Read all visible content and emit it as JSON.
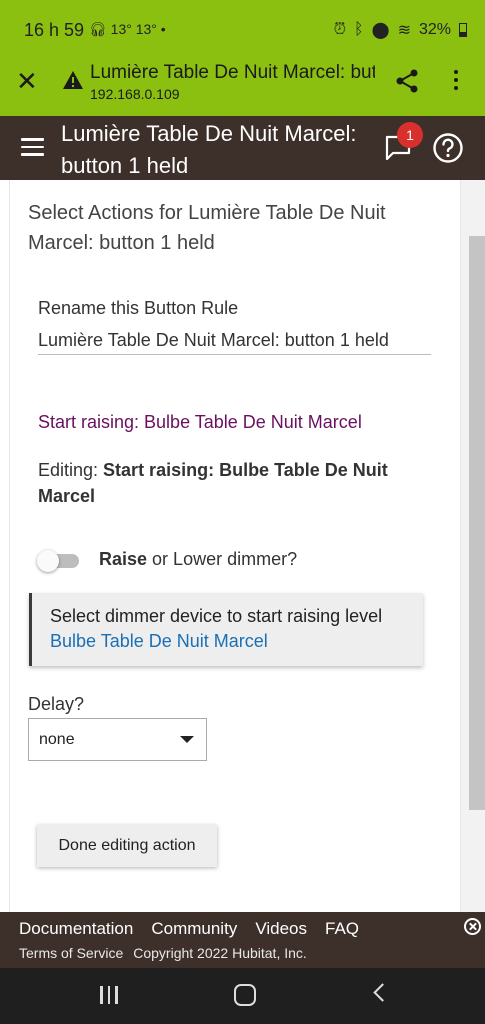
{
  "status_bar": {
    "time": "16 h 59",
    "weather": "13° 13°",
    "battery": "32%"
  },
  "browser": {
    "page_title": "Lumière Table De Nuit Marcel: button 1 held",
    "url": "192.168.0.109"
  },
  "app_header": {
    "title": "Lumière Table De Nuit Marcel: button 1 held",
    "notification_count": "1"
  },
  "main": {
    "heading": "Select Actions for Lumière Table De Nuit Marcel: button 1 held",
    "rename_label": "Rename this Button Rule",
    "rename_value": "Lumière Table De Nuit Marcel: button 1 held",
    "action_link": "Start raising: Bulbe Table De Nuit Marcel",
    "editing_prefix": "Editing: ",
    "editing_value": "Start raising: Bulbe Table De Nuit Marcel",
    "toggle": {
      "on": false,
      "bold_text": "Raise",
      "rest_text": " or Lower dimmer?"
    },
    "device_box": {
      "title": "Select dimmer device to start raising level",
      "value": "Bulbe Table De Nuit Marcel"
    },
    "delay": {
      "label": "Delay?",
      "value": "none"
    },
    "done_button": "Done editing action"
  },
  "footer": {
    "links": [
      "Documentation",
      "Community",
      "Videos",
      "FAQ"
    ],
    "terms": "Terms of Service",
    "copyright": "Copyright 2022 Hubitat, Inc."
  },
  "colors": {
    "accent_green": "#8bc010",
    "header_brown": "#3d2f2a",
    "action_purple": "#6a1060",
    "link_blue": "#1a6fb5",
    "badge_red": "#d9302d"
  }
}
